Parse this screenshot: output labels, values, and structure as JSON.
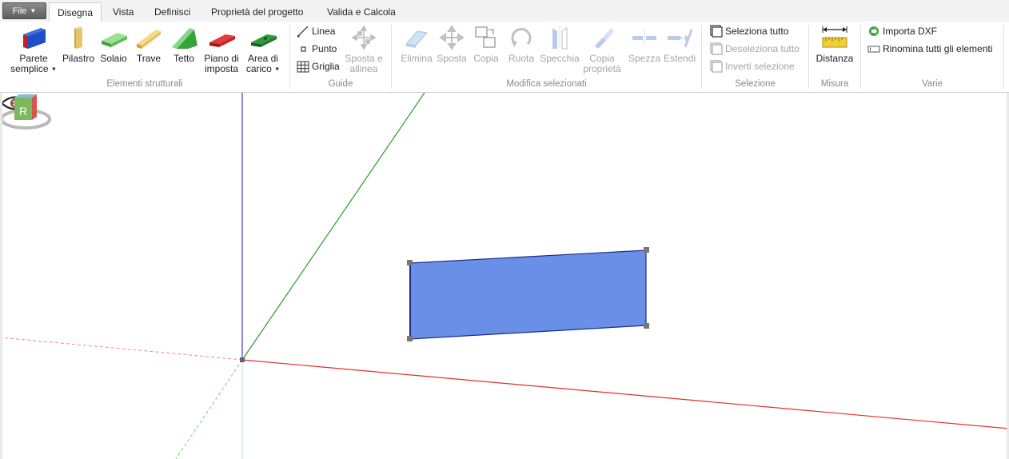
{
  "file_menu": {
    "label": "File"
  },
  "tabs": [
    {
      "label": "Disegna",
      "active": true
    },
    {
      "label": "Vista"
    },
    {
      "label": "Definisci"
    },
    {
      "label": "Proprietà del progetto"
    },
    {
      "label": "Valida e Calcola"
    }
  ],
  "groups": {
    "structural": {
      "label": "Elementi strutturali",
      "buttons": {
        "wall": {
          "line1": "Parete",
          "line2": "semplice",
          "icon": "wall-icon"
        },
        "column": {
          "line1": "Pilastro",
          "icon": "column-icon"
        },
        "slab": {
          "line1": "Solaio",
          "icon": "slab-icon"
        },
        "beam": {
          "line1": "Trave",
          "icon": "beam-icon"
        },
        "roof": {
          "line1": "Tetto",
          "icon": "roof-icon"
        },
        "base_plane": {
          "line1": "Piano di",
          "line2": "imposta",
          "icon": "base-plane-icon"
        },
        "load_area": {
          "line1": "Area di",
          "line2": "carico",
          "icon": "load-area-icon"
        }
      }
    },
    "guides": {
      "label": "Guide",
      "line": "Linea",
      "point": "Punto",
      "grid": "Griglia",
      "move_align": {
        "line1": "Sposta e",
        "line2": "allinea"
      }
    },
    "modify": {
      "label": "Modifica selezionati",
      "delete": "Elimina",
      "move": "Sposta",
      "copy": "Copia",
      "rotate": "Ruota",
      "mirror": "Specchia",
      "copy_props": {
        "line1": "Copia",
        "line2": "proprietà"
      },
      "split": "Spezza",
      "extend": "Estendi"
    },
    "selection": {
      "label": "Selezione",
      "select_all": "Seleziona tutto",
      "deselect_all": "Deseleziona tutto",
      "invert": "Inverti selezione"
    },
    "measure": {
      "label": "Misura",
      "distance": "Distanza"
    },
    "misc": {
      "label": "Varie",
      "import_dxf": "Importa DXF",
      "rename_all": "Rinomina tutti gli elementi"
    }
  },
  "viewport": {
    "nav_cube_label": "R",
    "colors": {
      "x_axis": "#e03030",
      "y_axis": "#2b9a2b",
      "z_axis": "#3a3ad0",
      "wall_fill": "#6a8fe6",
      "wall_stroke": "#1a2e8a"
    }
  }
}
